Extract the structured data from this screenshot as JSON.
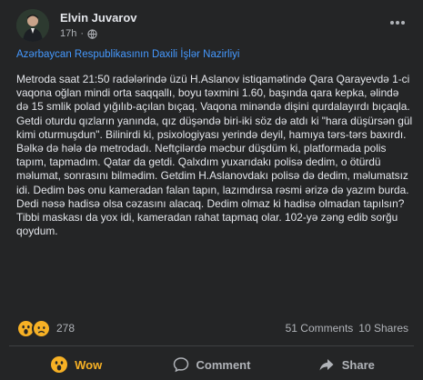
{
  "post": {
    "author": "Elvin Juvarov",
    "time": "17h",
    "dot": "·",
    "more_icon": "more-horizontal-icon",
    "link_title": "Azərbaycan Respublikasının Daxili İşlər Nazirliyi",
    "body": "Metroda saat 21:50 radələrində üzü H.Aslanov istiqamətində Qara Qarayevdə 1-ci vaqona oğlan mindi orta saqqallı, boyu təxmini 1.60, başında qara kepka, əlində də 15 smlik polad yığılıb-açılan bıçaq. Vaqona minəndə dişini qurdalayırdı bıçaqla. Getdi oturdu qızların yanında, qız düşəndə biri-iki söz də atdı ki \"hara düşürsən gül kimi oturmuşdun\". Bilinirdi ki, psixologiyası yerində deyil, hamıya tərs-tərs baxırdı. Bəlkə də hələ də metrodadı. Neftçilərdə məcbur düşdüm ki, platformada polis tapım, tapmadım. Qatar da getdi. Qalxdım yuxarıdakı polisə dedim, o ötürdü məlumat, sonrasını bilmədim. Getdim H.Aslanovdakı polisə də dedim, məlumatsız idi. Dedim bəs onu kameradan falan tapın, lazımdırsa rəsmi ərizə də yazım burda. Dedi nəsə hadisə olsa cəzasını alacaq. Dedim olmaz ki hadisə olmadan tapılsın? Tibbi maskası da yox idi, kameradan rahat tapmaq olar. 102-yə zəng edib sorğu qoydum."
  },
  "stats": {
    "reaction_count": "278",
    "comments": "51 Comments",
    "shares": "10 Shares",
    "reaction_icons": [
      "wow-reaction-icon",
      "sad-reaction-icon"
    ]
  },
  "actions": {
    "wow_label": "Wow",
    "comment_label": "Comment",
    "share_label": "Share"
  },
  "colors": {
    "background": "#242526",
    "text": "#e4e6eb",
    "secondary": "#b0b3b8",
    "link": "#4599ff",
    "wow": "#f7b125",
    "divider": "#3e4042"
  }
}
